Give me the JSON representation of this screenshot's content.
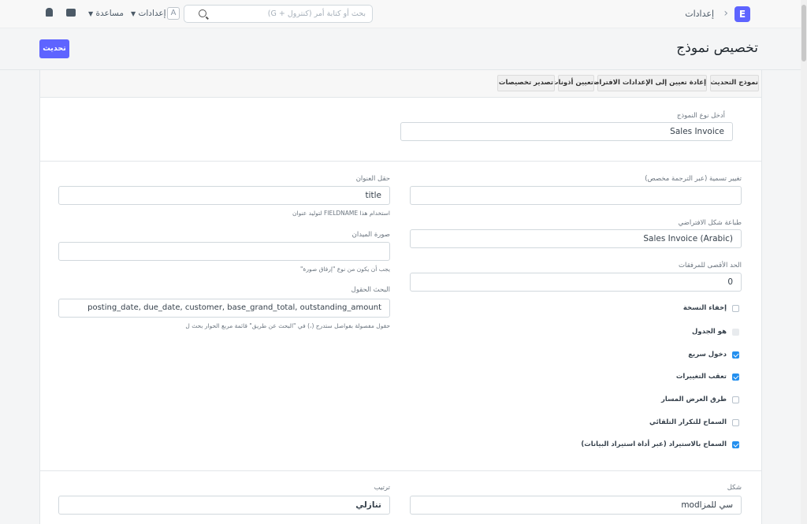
{
  "navbar": {
    "logo": "E",
    "breadcrumb": "إعدادات",
    "search_placeholder": "بحث أو كتابة أمر (كنترول + G)",
    "avatar": "A",
    "settings_label": "إعدادات",
    "help_label": "مساعدة"
  },
  "page": {
    "title": "تخصيص نموذج",
    "update_button": "تحديث"
  },
  "toolbar": {
    "doc_type": "نموذج التحديث",
    "reset": "إعادة تعيين إلى الإعدادات الافتراضية",
    "set_permissions": "تعيين أذونات",
    "export": "تصدير تخصيصات"
  },
  "form": {
    "doctype_label": "أدخل نوع النموذج",
    "doctype_value": "Sales Invoice",
    "rename_label": "تغيير تسمية (عبر الترجمة مخصص)",
    "rename_value": "",
    "title_field_label": "حقل العنوان",
    "title_field_value": "title",
    "title_field_help": "استخدام هذا FIELDNAME لتوليد عنوان",
    "default_print_label": "طباعة شكل الافتراضي",
    "default_print_value": "Sales Invoice (Arabic)",
    "image_field_label": "صورة الميدان",
    "image_field_value": "",
    "image_field_help": "يجب أن يكون من نوع \"إرفاق صورة\"",
    "max_attach_label": "الحد الأقصى للمرفقات",
    "max_attach_value": "0",
    "search_fields_label": "البحث الحقول",
    "search_fields_value": "posting_date, due_date, customer, base_grand_total, outstanding_amount",
    "search_fields_help": "حقول مفصولة بفواصل ستدرج (،) في \"البحث عن طريق\" قائمة مربع الحوار بحث ل",
    "sort_label": "ترتيب",
    "sort_value": "تنازلي",
    "shape_label": "شكل",
    "shape_value": "سي للمزاmod"
  },
  "checkboxes": [
    {
      "label": "إخفاء النسخة",
      "state": "off"
    },
    {
      "label": "هو الجدول",
      "state": "disabled"
    },
    {
      "label": "دخول سريع",
      "state": "on"
    },
    {
      "label": "تعقب التغييرات",
      "state": "on"
    },
    {
      "label": "طرق العرض المسار",
      "state": "off"
    },
    {
      "label": "السماح للتكرار التلقائي",
      "state": "off"
    },
    {
      "label": "السماح بالاستيراد (عبر أداة استيراد البيانات)",
      "state": "on"
    }
  ],
  "colors": {
    "primary": "#5e64ff",
    "checkbox_on": "#2490ef"
  }
}
